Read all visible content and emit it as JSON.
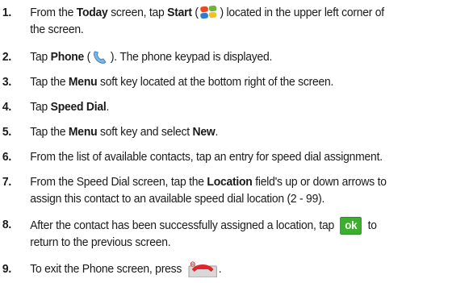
{
  "steps": [
    {
      "num": "1.",
      "l1a": "From the ",
      "l1b": "Today",
      "l1c": " screen, tap ",
      "l1d": "Start",
      "l1e": " (",
      "l1f": ") located in the upper left corner of",
      "l2": "the screen."
    },
    {
      "num": "2.",
      "a": "Tap ",
      "b": "Phone",
      "c": " (",
      "d": "). The phone keypad is displayed."
    },
    {
      "num": "3.",
      "a": "Tap the ",
      "b": "Menu",
      "c": " soft key located at the bottom right of the screen."
    },
    {
      "num": "4.",
      "a": "Tap ",
      "b": "Speed Dial",
      "c": "."
    },
    {
      "num": "5.",
      "a": "Tap the ",
      "b": "Menu",
      "c": " soft key and select ",
      "d": "New",
      "e": "."
    },
    {
      "num": "6.",
      "a": "From the list of available contacts, tap an entry for speed dial assignment."
    },
    {
      "num": "7.",
      "a": "From the Speed Dial screen, tap the ",
      "b": "Location",
      "c": " field's up or down arrows to",
      "l2": "assign this contact to an available speed dial location (2 - 99)."
    },
    {
      "num": "8.",
      "a": "After the contact has been successfully assigned a location, tap ",
      "ok": "ok",
      "c": " to",
      "l2": "return to the previous screen."
    },
    {
      "num": "9.",
      "a": "To exit the Phone screen, press ",
      "c": "."
    }
  ],
  "icons": {
    "start": "windows-start-icon",
    "phone": "phone-handset-icon",
    "ok": "ok-button-icon",
    "end": "end-call-key-icon"
  },
  "colors": {
    "text": "#1a1a1a",
    "ok_green": "#3cb02e",
    "end_red": "#e0262a"
  }
}
